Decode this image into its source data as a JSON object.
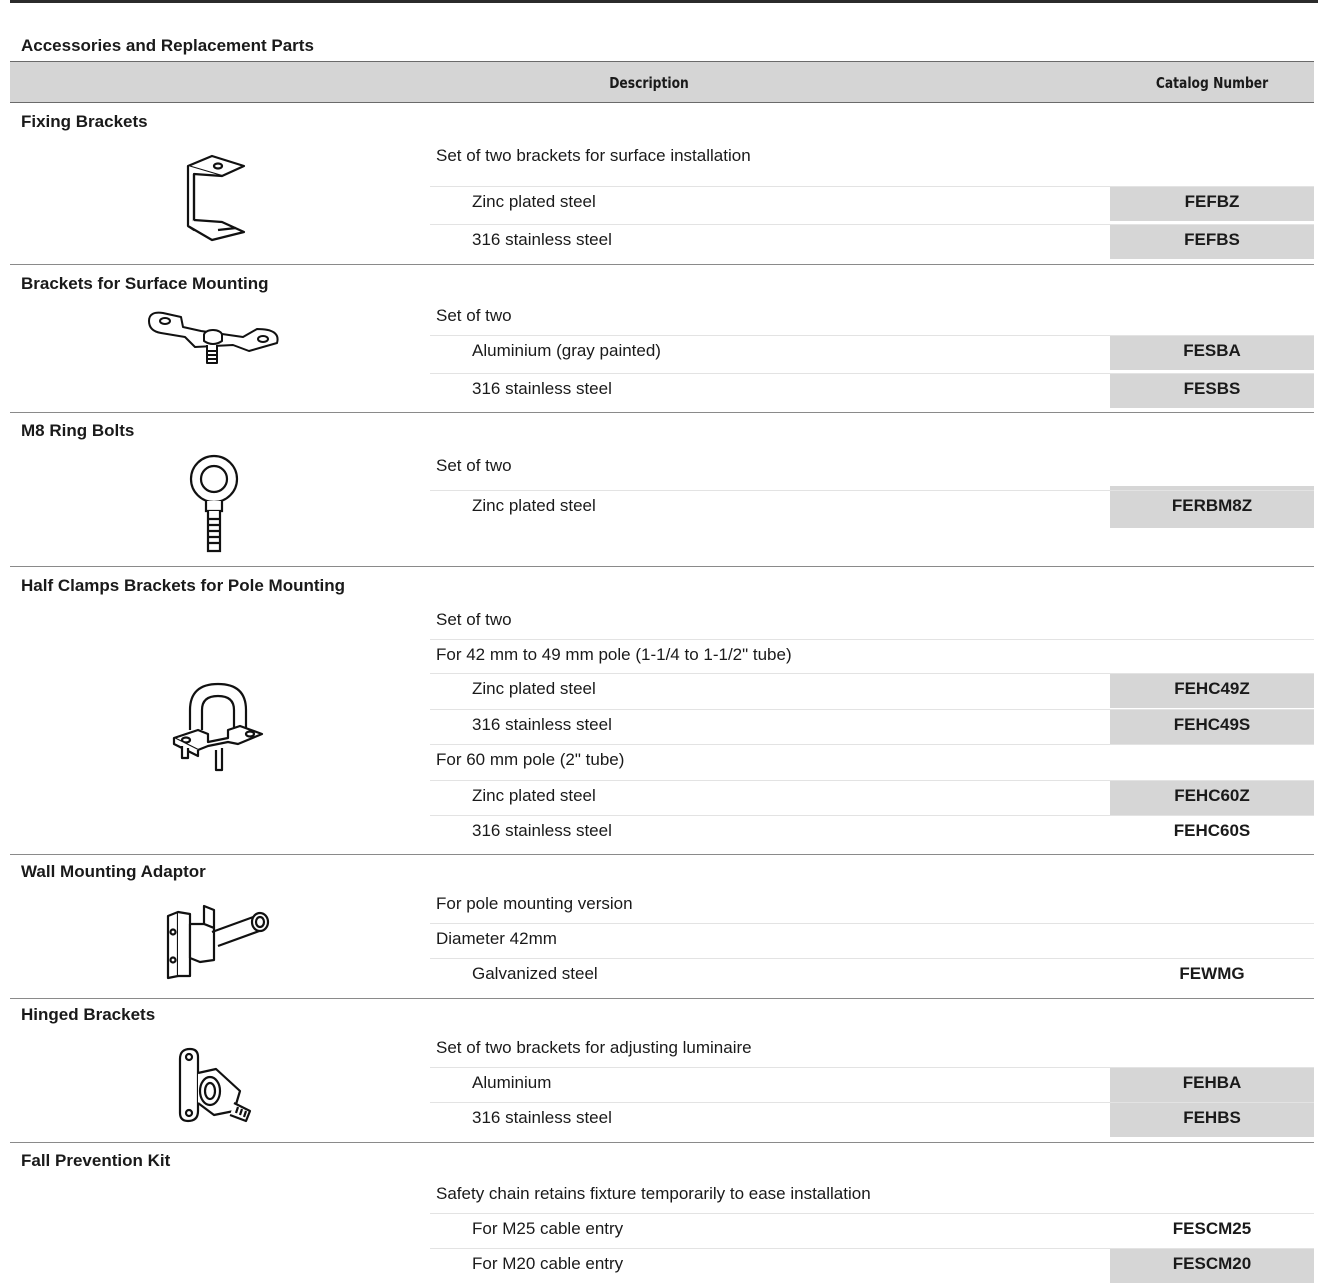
{
  "title": "Accessories and Replacement Parts",
  "header": {
    "description": "Description",
    "catalog_number": "Catalog Number"
  },
  "sections": [
    {
      "name": "Fixing Brackets",
      "icon": "fixing-bracket-icon",
      "rows": [
        {
          "text": "Set of two brackets for surface installation",
          "catalog": ""
        },
        {
          "text": "Zinc plated steel",
          "catalog": "FEFBZ"
        },
        {
          "text": "316 stainless steel",
          "catalog": "FEFBS"
        }
      ]
    },
    {
      "name": "Brackets for Surface Mounting",
      "icon": "surface-bracket-icon",
      "rows": [
        {
          "text": "Set of two",
          "catalog": ""
        },
        {
          "text": "Aluminium (gray painted)",
          "catalog": "FESBA"
        },
        {
          "text": "316 stainless steel",
          "catalog": "FESBS"
        }
      ]
    },
    {
      "name": "M8 Ring Bolts",
      "icon": "ring-bolt-icon",
      "rows": [
        {
          "text": "Set of two",
          "catalog": ""
        },
        {
          "text": "Zinc plated steel",
          "catalog": "FERBM8Z"
        }
      ]
    },
    {
      "name": "Half Clamps Brackets for Pole Mounting",
      "icon": "pole-clamp-icon",
      "rows": [
        {
          "text": "Set of two",
          "catalog": ""
        },
        {
          "text": "For 42 mm to 49 mm pole (1-1/4 to 1-1/2\" tube)",
          "catalog": ""
        },
        {
          "text": "Zinc plated steel",
          "catalog": "FEHC49Z"
        },
        {
          "text": "316 stainless steel",
          "catalog": "FEHC49S"
        },
        {
          "text": "For 60 mm pole (2\" tube)",
          "catalog": ""
        },
        {
          "text": "Zinc plated steel",
          "catalog": "FEHC60Z"
        },
        {
          "text": "316 stainless steel",
          "catalog": "FEHC60S"
        }
      ]
    },
    {
      "name": "Wall Mounting Adaptor",
      "icon": "wall-adaptor-icon",
      "rows": [
        {
          "text": "For pole mounting version",
          "catalog": ""
        },
        {
          "text": "Diameter 42mm",
          "catalog": ""
        },
        {
          "text": "Galvanized steel",
          "catalog": "FEWMG"
        }
      ]
    },
    {
      "name": "Hinged Brackets",
      "icon": "hinged-bracket-icon",
      "rows": [
        {
          "text": "Set of two brackets for adjusting luminaire",
          "catalog": ""
        },
        {
          "text": "Aluminium",
          "catalog": "FEHBA"
        },
        {
          "text": "316 stainless steel",
          "catalog": "FEHBS"
        }
      ]
    },
    {
      "name": "Fall Prevention Kit",
      "icon": "",
      "rows": [
        {
          "text": "Safety chain retains fixture temporarily to ease installation",
          "catalog": ""
        },
        {
          "text": "For M25 cable entry",
          "catalog": "FESCM25"
        },
        {
          "text": "For M20 cable entry",
          "catalog": "FESCM20"
        }
      ]
    }
  ]
}
